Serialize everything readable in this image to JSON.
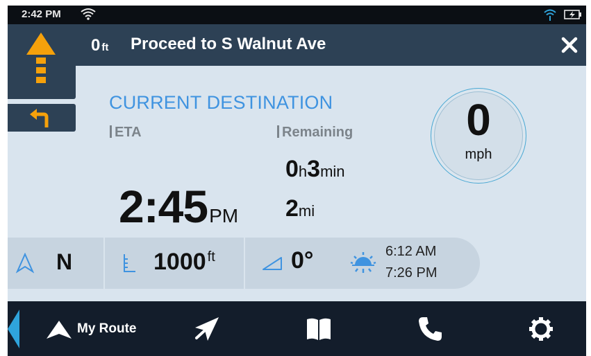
{
  "status_bar": {
    "time": "2:42 PM",
    "wifi_icon": "wifi-icon",
    "signal_icon": "signal-icon",
    "battery_icon": "battery-charging-icon"
  },
  "instruction": {
    "distance_value": "0",
    "distance_unit": "ft",
    "text": "Proceed to S Walnut Ave",
    "turn_icon": "straight-arrow-icon",
    "next_turn_icon": "turn-left-icon",
    "close_icon": "close-icon"
  },
  "destination": {
    "title": "CURRENT DESTINATION",
    "eta_label": "ETA",
    "remaining_label": "Remaining",
    "eta_time": "2:45",
    "eta_ampm": "PM",
    "remaining_hours": "0",
    "remaining_hours_unit": "h",
    "remaining_minutes": "3",
    "remaining_minutes_unit": "min",
    "remaining_distance": "2",
    "remaining_distance_unit": "mi"
  },
  "speed": {
    "value": "0",
    "unit": "mph"
  },
  "info_strip": {
    "heading": "N",
    "altitude_value": "1000",
    "altitude_unit": "ft",
    "slope": "0°",
    "sunrise": "6:12 AM",
    "sunset": "7:26 PM"
  },
  "nav": {
    "route_label": "My Route",
    "items": [
      "back-tab",
      "my-route",
      "navigate-icon",
      "book-icon",
      "phone-icon",
      "gear-icon"
    ]
  },
  "colors": {
    "accent_blue": "#3f93e0",
    "instruction_bar": "#2d4155",
    "turn_arrow": "#f6a10b",
    "nav_bar": "#131d2b",
    "panel_bg": "#d9e4ee",
    "back_tab": "#2fa4dc"
  }
}
